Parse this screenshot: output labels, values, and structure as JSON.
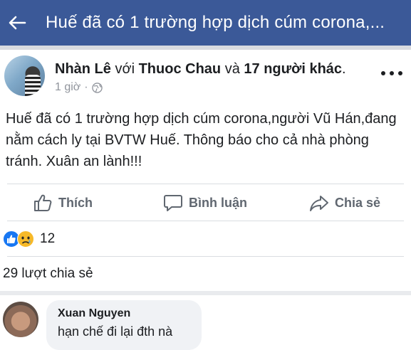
{
  "header": {
    "title": "Huế đã có 1 trường hợp dịch cúm corona,..."
  },
  "post": {
    "author": "Nhàn Lê",
    "with_word": "với",
    "tagged_person": "Thuoc Chau",
    "and_word": "và",
    "others_text": "17 người khác",
    "period": ".",
    "time": "1 giờ",
    "separator": "·",
    "text": "Huế đã có 1 trường hợp dịch cúm corona,người Vũ Hán,đang nằm cách ly tại BVTW Huế. Thông báo cho cả nhà phòng tránh. Xuân an lành!!!"
  },
  "actions": {
    "like": "Thích",
    "comment": "Bình luận",
    "share": "Chia sẻ"
  },
  "reactions": {
    "count": "12",
    "types": [
      "like-icon",
      "sad-icon"
    ]
  },
  "shares": {
    "text": "29 lượt chia sẻ"
  },
  "comment": {
    "author": "Xuan Nguyen",
    "text": "hạn chế đi lại đth nà"
  },
  "colors": {
    "header_bg": "#3b5998",
    "like_blue": "#1877f2",
    "sad_yellow": "#f7b928"
  }
}
